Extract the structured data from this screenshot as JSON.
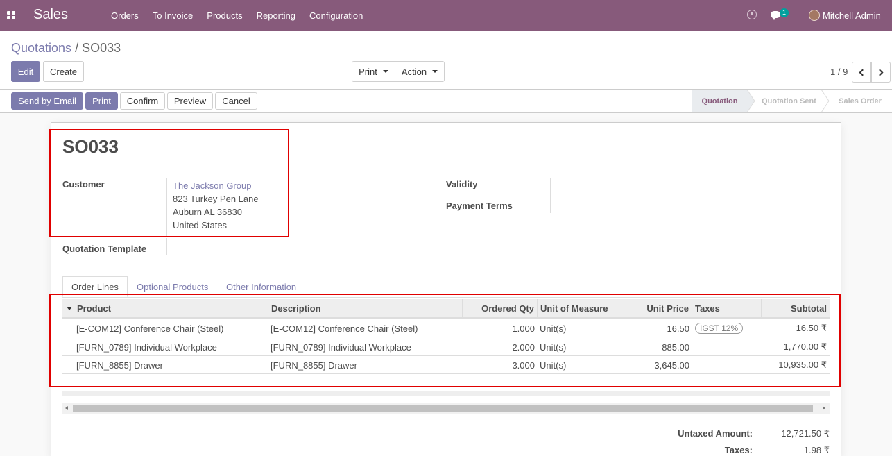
{
  "navbar": {
    "app_name": "Sales",
    "menu": [
      "Orders",
      "To Invoice",
      "Products",
      "Reporting",
      "Configuration"
    ],
    "chat_badge": "1",
    "user": "Mitchell Admin"
  },
  "breadcrumb": {
    "parent": "Quotations",
    "separator": "/",
    "current": "SO033"
  },
  "toolbar": {
    "edit": "Edit",
    "create": "Create",
    "print": "Print",
    "action": "Action",
    "pager": "1 / 9"
  },
  "statusbar": {
    "buttons": [
      "Send by Email",
      "Print",
      "Confirm",
      "Preview",
      "Cancel"
    ],
    "stages": [
      "Quotation",
      "Quotation Sent",
      "Sales Order"
    ],
    "active_stage": "Quotation"
  },
  "form": {
    "name": "SO033",
    "customer_label": "Customer",
    "customer_name": "The Jackson Group",
    "address": [
      "823 Turkey Pen Lane",
      "Auburn AL 36830",
      "United States"
    ],
    "validity_label": "Validity",
    "payment_terms_label": "Payment Terms",
    "template_label": "Quotation Template"
  },
  "tabs": [
    "Order Lines",
    "Optional Products",
    "Other Information"
  ],
  "order_lines": {
    "columns": [
      "Product",
      "Description",
      "Ordered Qty",
      "Unit of Measure",
      "Unit Price",
      "Taxes",
      "Subtotal"
    ],
    "rows": [
      {
        "product": "[E-COM12] Conference Chair (Steel)",
        "description": "[E-COM12] Conference Chair (Steel)",
        "qty": "1.000",
        "uom": "Unit(s)",
        "price": "16.50",
        "tax": "IGST 12%",
        "subtotal": "16.50 ₹"
      },
      {
        "product": "[FURN_0789] Individual Workplace",
        "description": "[FURN_0789] Individual Workplace",
        "qty": "2.000",
        "uom": "Unit(s)",
        "price": "885.00",
        "tax": "",
        "subtotal": "1,770.00 ₹"
      },
      {
        "product": "[FURN_8855] Drawer",
        "description": "[FURN_8855] Drawer",
        "qty": "3.000",
        "uom": "Unit(s)",
        "price": "3,645.00",
        "tax": "",
        "subtotal": "10,935.00 ₹"
      }
    ]
  },
  "totals": {
    "untaxed_label": "Untaxed Amount:",
    "untaxed_value": "12,721.50 ₹",
    "taxes_label": "Taxes:",
    "taxes_value": "1.98 ₹"
  },
  "colors": {
    "brand": "#875a7b",
    "accent": "#7c7bad",
    "highlight": "#e00000"
  }
}
